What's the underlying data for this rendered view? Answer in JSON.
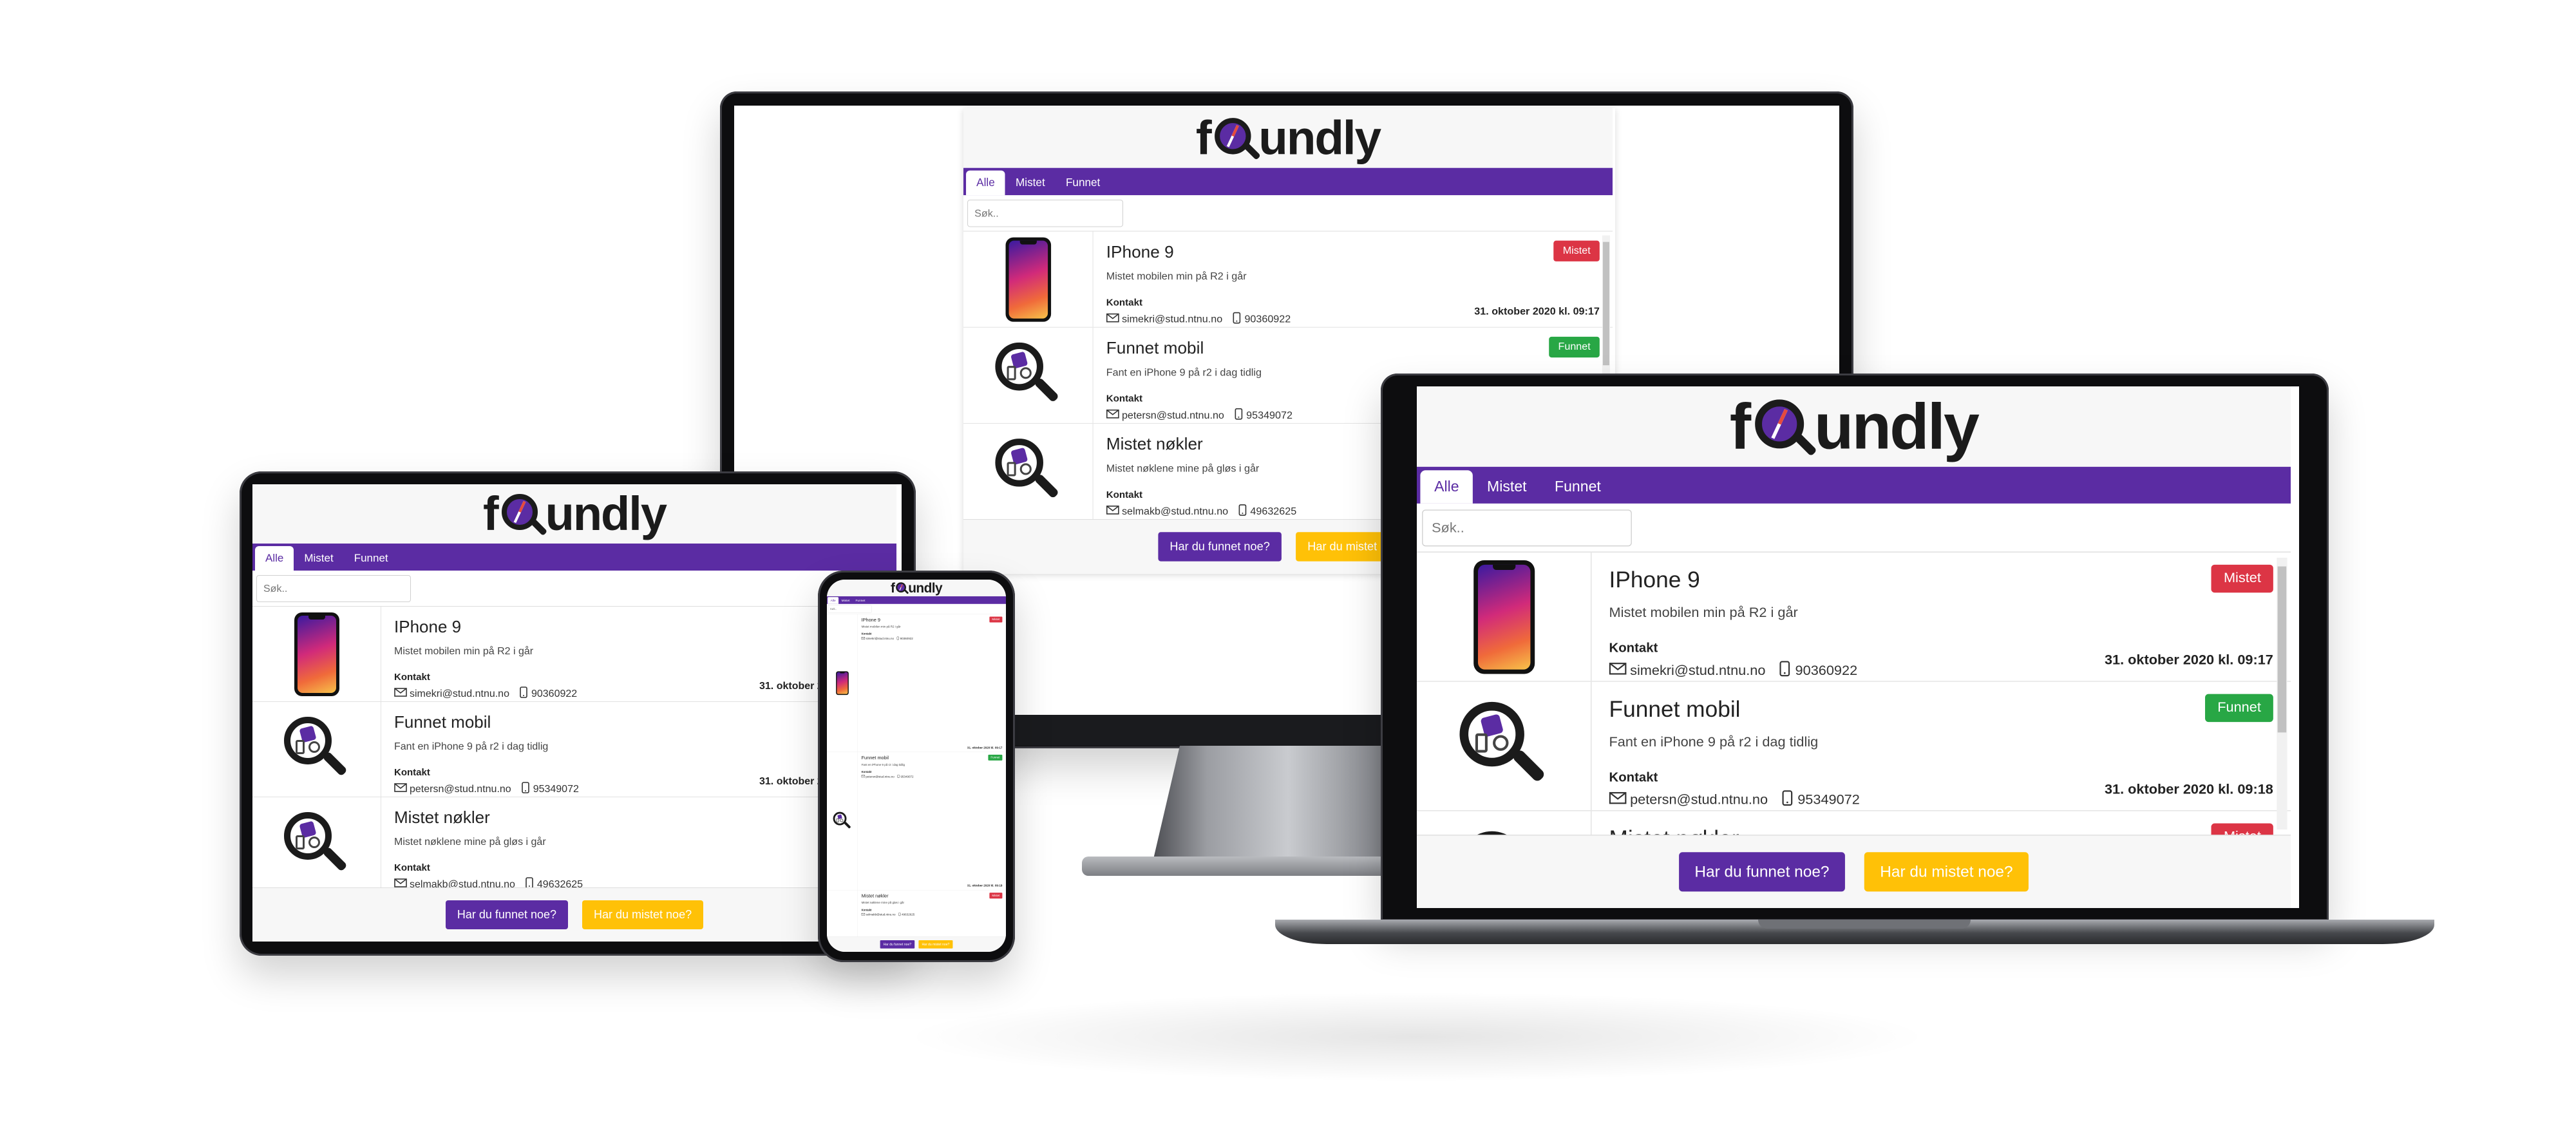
{
  "app": {
    "logo": {
      "left": "f",
      "right": "undly"
    },
    "tabs": [
      "Alle",
      "Mistet",
      "Funnet"
    ],
    "search_placeholder": "Søk..",
    "contact_heading": "Kontakt",
    "items": [
      {
        "title": "IPhone 9",
        "desc": "Mistet mobilen min på R2 i går",
        "email": "simekri@stud.ntnu.no",
        "phone": "90360922",
        "date": "31. oktober 2020 kl. 09:17",
        "status": "Mistet",
        "thumb": "phone-icon"
      },
      {
        "title": "Funnet mobil",
        "desc": "Fant en iPhone 9 på r2 i dag tidlig",
        "email": "petersn@stud.ntnu.no",
        "phone": "95349072",
        "date": "31. oktober 2020 kl. 09:18",
        "status": "Funnet",
        "thumb": "magnifier-icon"
      },
      {
        "title": "Mistet nøkler",
        "desc": "Mistet nøklene mine på gløs i går",
        "email": "selmakb@stud.ntnu.no",
        "phone": "49632625",
        "date": "",
        "status": "Mistet",
        "thumb": "magnifier-icon"
      }
    ],
    "buttons": {
      "found": "Har du funnet noe?",
      "lost": "Har du mistet noe?"
    }
  },
  "colors": {
    "primary": "#5b2ca3",
    "lost": "#dc3545",
    "found": "#28a745",
    "lost_button": "#ffc107"
  }
}
